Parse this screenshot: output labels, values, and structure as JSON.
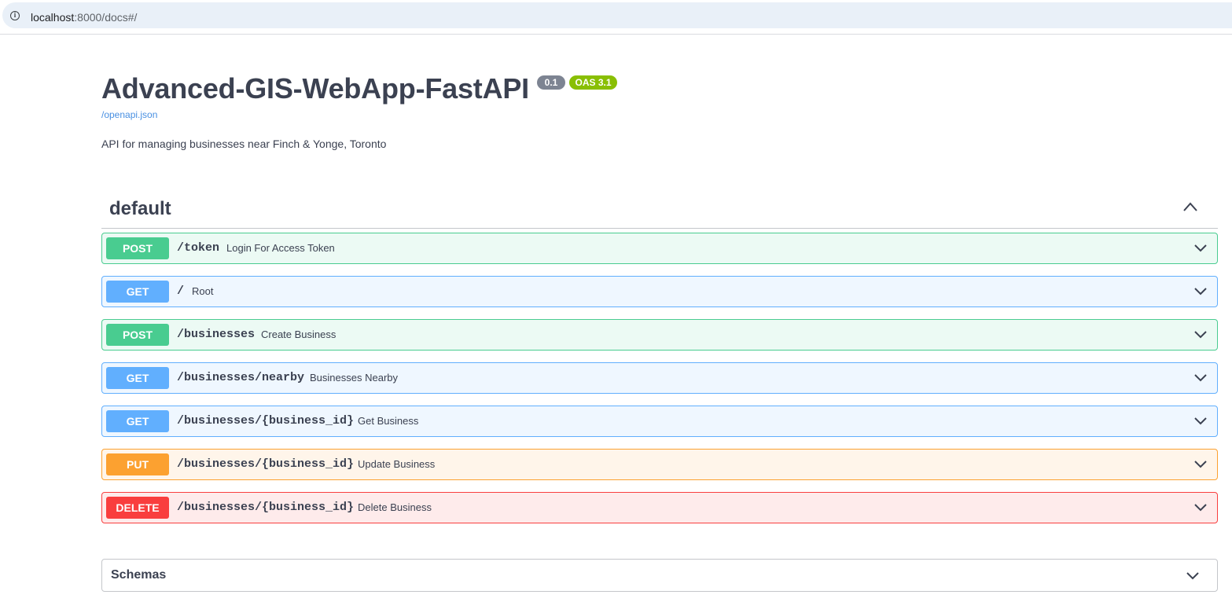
{
  "browser": {
    "url_host": "localhost",
    "url_path": ":8000/docs#/"
  },
  "info": {
    "title": "Advanced-GIS-WebApp-FastAPI",
    "version": "0.1",
    "oas": "OAS 3.1",
    "spec_link": "/openapi.json",
    "description": "API for managing businesses near Finch & Yonge, Toronto"
  },
  "tag": {
    "name": "default"
  },
  "operations": [
    {
      "method": "POST",
      "path": "/token",
      "summary": "Login For Access Token"
    },
    {
      "method": "GET",
      "path": "/",
      "summary": "Root"
    },
    {
      "method": "POST",
      "path": "/businesses",
      "summary": "Create Business"
    },
    {
      "method": "GET",
      "path": "/businesses/nearby",
      "summary": "Businesses Nearby"
    },
    {
      "method": "GET",
      "path": "/businesses/{business_id}",
      "summary": "Get Business"
    },
    {
      "method": "PUT",
      "path": "/businesses/{business_id}",
      "summary": "Update Business"
    },
    {
      "method": "DELETE",
      "path": "/businesses/{business_id}",
      "summary": "Delete Business"
    }
  ],
  "schemas": {
    "title": "Schemas"
  },
  "colors": {
    "post": "#49cc90",
    "get": "#61affe",
    "put": "#fca130",
    "delete": "#f93e3e",
    "badge_version": "#7d8492",
    "badge_oas": "#89bf04"
  }
}
